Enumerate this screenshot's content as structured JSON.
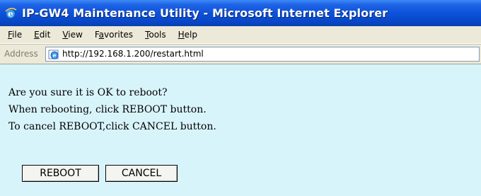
{
  "window": {
    "title": "IP-GW4 Maintenance Utility - Microsoft Internet Explorer"
  },
  "menu": {
    "items": [
      {
        "accel": "F",
        "rest": "ile"
      },
      {
        "accel": "E",
        "rest": "dit"
      },
      {
        "accel": "V",
        "rest": "iew"
      },
      {
        "accel": "a",
        "pre": "F",
        "rest": "vorites"
      },
      {
        "accel": "T",
        "rest": "ools"
      },
      {
        "accel": "H",
        "rest": "elp"
      }
    ]
  },
  "address": {
    "label": "Address",
    "url": "http://192.168.1.200/restart.html"
  },
  "content": {
    "line1": "Are you sure it is OK to reboot?",
    "line2": "When rebooting, click REBOOT button.",
    "line3": "To cancel REBOOT,click CANCEL button.",
    "reboot_label": "REBOOT",
    "cancel_label": "CANCEL"
  }
}
